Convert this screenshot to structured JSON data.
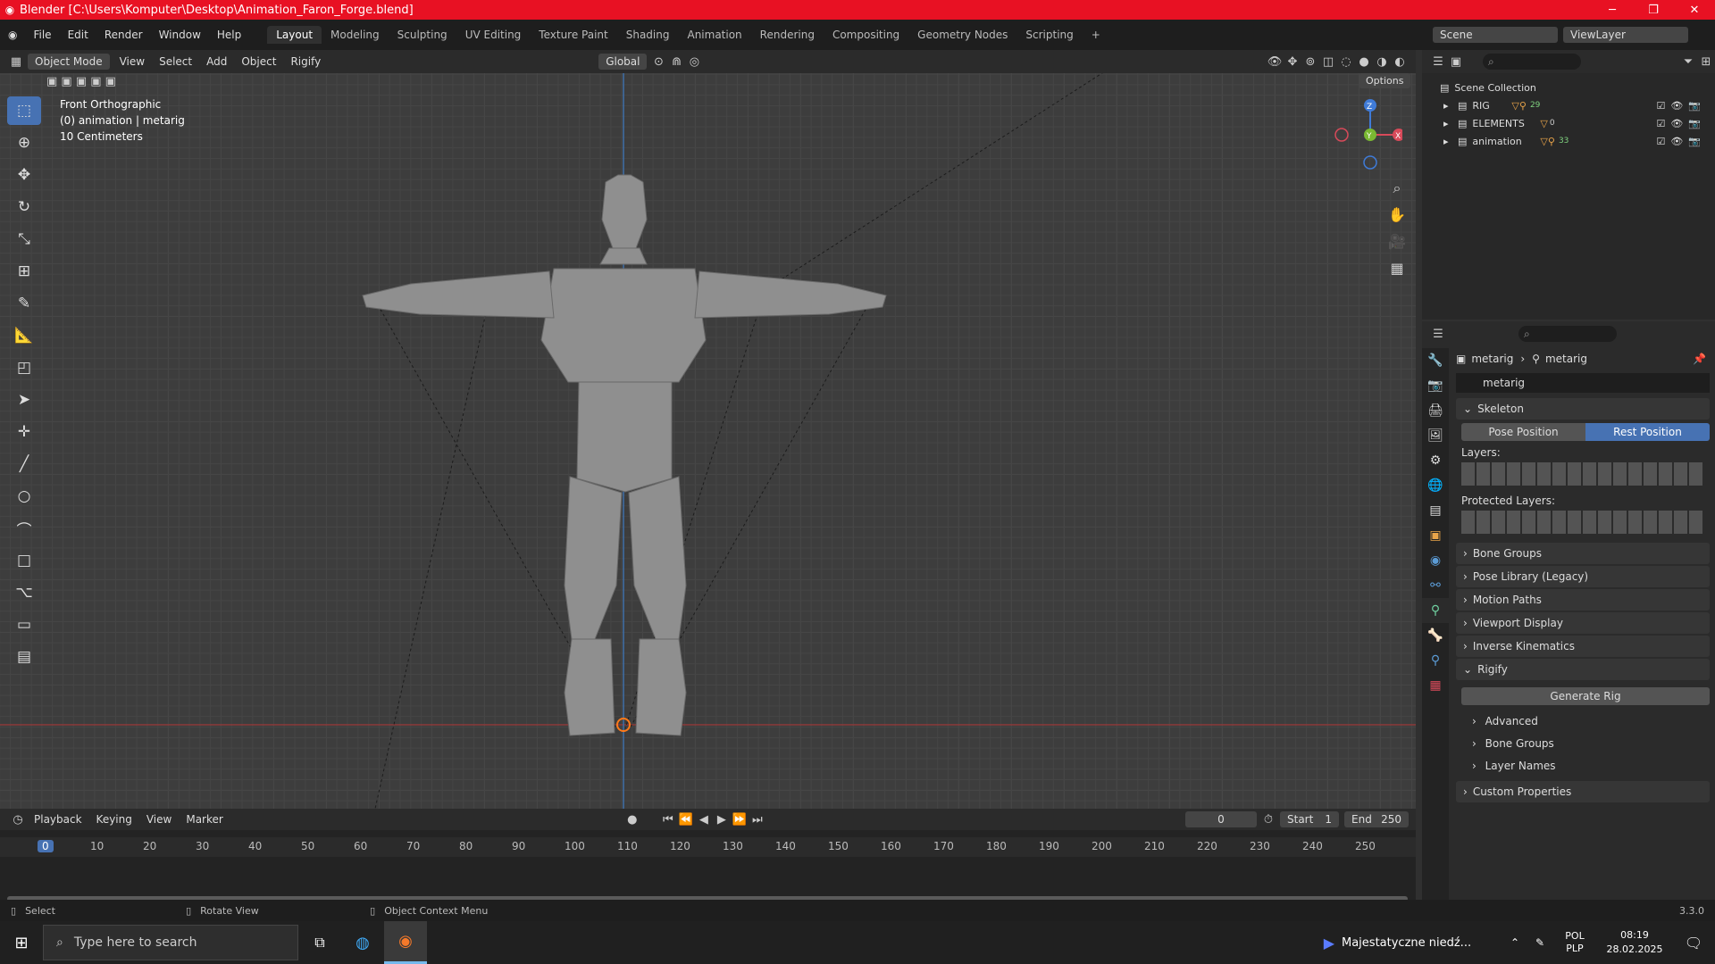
{
  "titlebar": {
    "title": "Blender [C:\\Users\\Komputer\\Desktop\\Animation_Faron_Forge.blend]"
  },
  "menu": [
    "File",
    "Edit",
    "Render",
    "Window",
    "Help"
  ],
  "workspaces": [
    "Layout",
    "Modeling",
    "Sculpting",
    "UV Editing",
    "Texture Paint",
    "Shading",
    "Animation",
    "Rendering",
    "Compositing",
    "Geometry Nodes",
    "Scripting"
  ],
  "scene": "Scene",
  "view_layer": "ViewLayer",
  "viewport": {
    "mode": "Object Mode",
    "menus": [
      "View",
      "Select",
      "Add",
      "Object",
      "Rigify"
    ],
    "transform": "Global",
    "options": "Options",
    "overlay": [
      "Front Orthographic",
      "(0) animation | metarig",
      "10 Centimeters"
    ],
    "gizmo": {
      "z": "Z",
      "y": "Y",
      "x": "X"
    }
  },
  "outliner": {
    "root": "Scene Collection",
    "items": [
      {
        "name": "RIG",
        "count": "29"
      },
      {
        "name": "ELEMENTS",
        "count": "0"
      },
      {
        "name": "animation",
        "count": "33"
      }
    ]
  },
  "properties": {
    "breadcrumb1": "metarig",
    "breadcrumb2": "metarig",
    "datablock": "metarig",
    "skeleton": "Skeleton",
    "pose_btn": "Pose Position",
    "rest_btn": "Rest Position",
    "layers": "Layers:",
    "protected": "Protected Layers:",
    "panels": [
      "Bone Groups",
      "Pose Library (Legacy)",
      "Motion Paths",
      "Viewport Display",
      "Inverse Kinematics"
    ],
    "rigify": "Rigify",
    "generate": "Generate Rig",
    "sub": [
      "Advanced",
      "Bone Groups",
      "Layer Names"
    ],
    "custom": "Custom Properties"
  },
  "timeline": {
    "menus": [
      "Playback",
      "Keying",
      "View",
      "Marker"
    ],
    "frame": "0",
    "start_label": "Start",
    "start": "1",
    "end_label": "End",
    "end": "250",
    "ticks": [
      "0",
      "10",
      "20",
      "30",
      "40",
      "50",
      "60",
      "70",
      "80",
      "90",
      "100",
      "110",
      "120",
      "130",
      "140",
      "150",
      "160",
      "170",
      "180",
      "190",
      "200",
      "210",
      "220",
      "230",
      "240",
      "250"
    ]
  },
  "status": {
    "select": "Select",
    "rotate": "Rotate View",
    "context": "Object Context Menu",
    "version": "3.3.0"
  },
  "taskbar": {
    "search": "Type here to search",
    "media": "Majestatyczne niedź...",
    "lang1": "POL",
    "lang2": "PLP",
    "time": "08:19",
    "date": "28.02.2025"
  }
}
